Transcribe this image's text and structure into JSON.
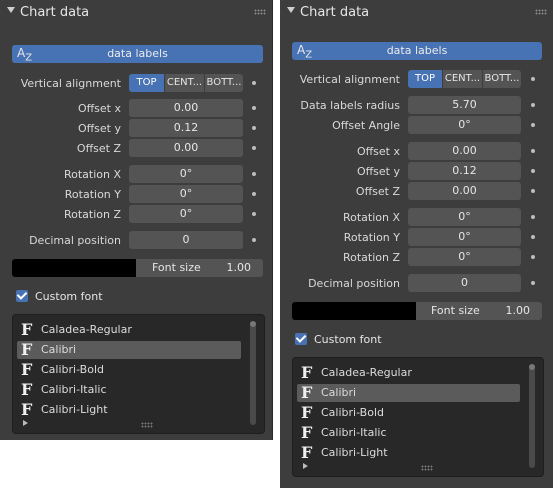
{
  "left": {
    "title": "Chart data",
    "data_bar_label": "data labels",
    "az_icon": "AZ",
    "vertical_alignment": {
      "label": "Vertical alignment",
      "options": [
        "TOP",
        "CENT...",
        "BOTT..."
      ],
      "selected": "TOP"
    },
    "offset_x": {
      "label": "Offset x",
      "value": "0.00"
    },
    "offset_y": {
      "label": "Offset y",
      "value": "0.12"
    },
    "offset_z": {
      "label": "Offset Z",
      "value": "0.00"
    },
    "rotation_x": {
      "label": "Rotation X",
      "value": "0°"
    },
    "rotation_y": {
      "label": "Rotation Y",
      "value": "0°"
    },
    "rotation_z": {
      "label": "Rotation Z",
      "value": "0°"
    },
    "decimal_position": {
      "label": "Decimal position",
      "value": "0"
    },
    "font_size": {
      "label": "Font size",
      "value": "1.00"
    },
    "custom_font": {
      "label": "Custom font",
      "checked": true
    },
    "fonts": [
      "Caladea-Regular",
      "Calibri",
      "Calibri-Bold",
      "Calibri-Italic",
      "Calibri-Light"
    ],
    "selected_font": "Calibri"
  },
  "right": {
    "title": "Chart data",
    "data_bar_label": "data labels",
    "az_icon": "AZ",
    "vertical_alignment": {
      "label": "Vertical alignment",
      "options": [
        "TOP",
        "CENT...",
        "BOTT..."
      ],
      "selected": "TOP"
    },
    "data_labels_radius": {
      "label": "Data labels radius",
      "value": "5.70"
    },
    "offset_angle": {
      "label": "Offset Angle",
      "value": "0°"
    },
    "offset_x": {
      "label": "Offset x",
      "value": "0.00"
    },
    "offset_y": {
      "label": "Offset y",
      "value": "0.12"
    },
    "offset_z": {
      "label": "Offset Z",
      "value": "0.00"
    },
    "rotation_x": {
      "label": "Rotation X",
      "value": "0°"
    },
    "rotation_y": {
      "label": "Rotation Y",
      "value": "0°"
    },
    "rotation_z": {
      "label": "Rotation Z",
      "value": "0°"
    },
    "decimal_position": {
      "label": "Decimal position",
      "value": "0"
    },
    "font_size": {
      "label": "Font size",
      "value": "1.00"
    },
    "custom_font": {
      "label": "Custom font",
      "checked": true
    },
    "fonts": [
      "Caladea-Regular",
      "Calibri",
      "Calibri-Bold",
      "Calibri-Italic",
      "Calibri-Light"
    ],
    "selected_font": "Calibri"
  },
  "colors": {
    "accent": "#4772b3",
    "panel": "#3d3d3d",
    "field": "#545454",
    "list_bg": "#282828"
  },
  "icons": {
    "font_item": "font-f-icon",
    "collapse": "chevron-down-icon",
    "grip": "grip-dots-icon",
    "checkbox": "checkmark-icon"
  }
}
